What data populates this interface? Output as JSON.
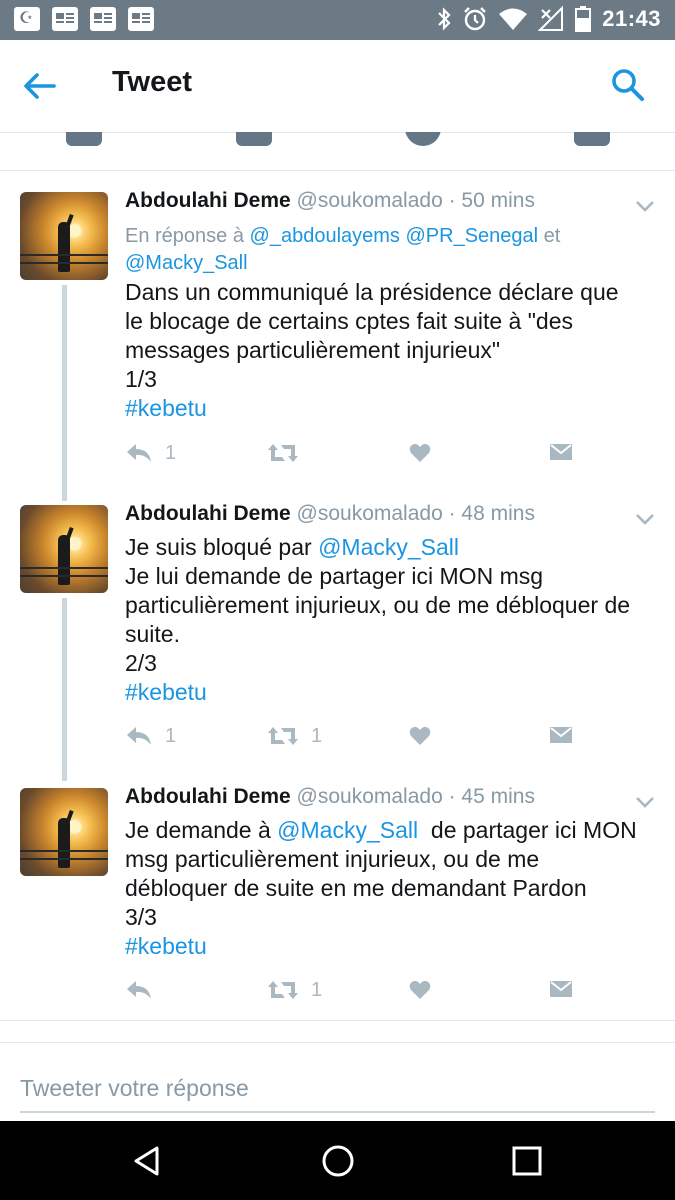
{
  "status_bar": {
    "time": "21:43"
  },
  "app_bar": {
    "title": "Tweet"
  },
  "tweets": [
    {
      "name": "Abdoulahi Deme",
      "handle": "@soukomalado",
      "time": "· 50 mins",
      "reply_prefix": "En réponse à ",
      "reply_users_line1": "@_abdoulayems @PR_Senegal",
      "reply_and": " et",
      "reply_users_line2": "@Macky_Sall",
      "lines": [
        "Dans un communiqué la présidence déclare que",
        "le blocage de certains cptes fait suite à \"des",
        "messages particulièrement injurieux\"",
        "1/3"
      ],
      "hashtag": "#kebetu",
      "reply_count": "1",
      "retweet_count": ""
    },
    {
      "name": "Abdoulahi Deme",
      "handle": "@soukomalado",
      "time": "· 48 mins",
      "line1_prefix": "Je suis bloqué par ",
      "line1_mention": "@Macky_Sall",
      "lines": [
        "Je lui demande de partager ici MON msg",
        "particulièrement injurieux, ou de me débloquer de",
        "suite.",
        "2/3"
      ],
      "hashtag": "#kebetu",
      "reply_count": "1",
      "retweet_count": "1"
    },
    {
      "name": "Abdoulahi Deme",
      "handle": "@soukomalado",
      "time": "· 45 mins",
      "line1_prefix": "Je demande à ",
      "line1_mention": "@Macky_Sall",
      "line1_suffix": "  de partager ici MON",
      "lines": [
        "msg particulièrement injurieux, ou de me",
        "débloquer de suite en me demandant Pardon",
        "3/3"
      ],
      "hashtag": "#kebetu",
      "reply_count": "",
      "retweet_count": "1"
    }
  ],
  "composer": {
    "placeholder": "Tweeter votre réponse"
  },
  "colors": {
    "link": "#1b95e0",
    "muted": "#8899a6",
    "status_bar": "#6c7a86",
    "icon": "#aab8c2"
  },
  "icons": [
    "back-arrow-icon",
    "search-icon",
    "reply-icon",
    "retweet-icon",
    "like-icon",
    "message-icon",
    "chevron-down-icon",
    "nav-back-icon",
    "nav-home-icon",
    "nav-recents-icon"
  ]
}
